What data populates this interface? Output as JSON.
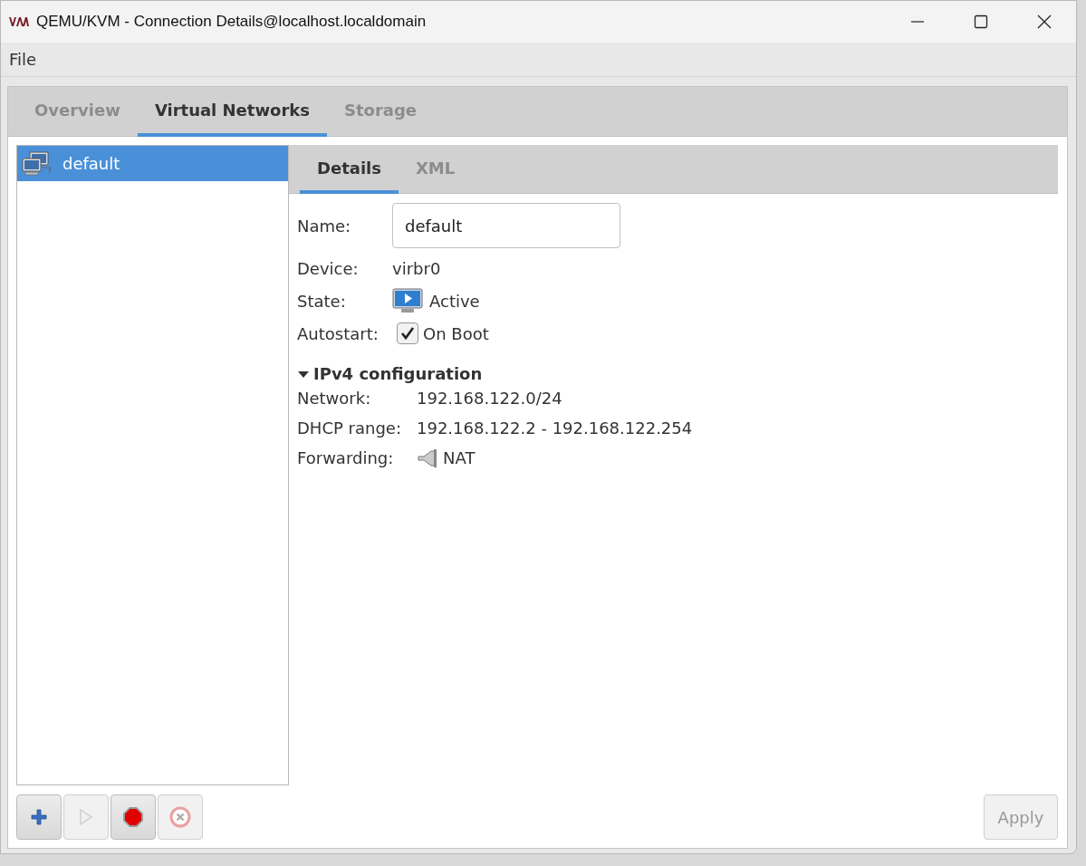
{
  "window": {
    "title": "QEMU/KVM - Connection Details@localhost.localdomain"
  },
  "menu": [
    "File"
  ],
  "tabs": [
    {
      "label": "Overview",
      "selected": false
    },
    {
      "label": "Virtual Networks",
      "selected": true
    },
    {
      "label": "Storage",
      "selected": false
    }
  ],
  "networks": [
    {
      "name": "default",
      "selected": true
    }
  ],
  "detail_tabs": [
    {
      "label": "Details",
      "selected": true
    },
    {
      "label": "XML",
      "selected": false
    }
  ],
  "details": [
    {
      "kind": "field",
      "label": "Name:",
      "value": "default"
    },
    {
      "kind": "text",
      "label": "Device:",
      "value": "virbr0"
    },
    {
      "kind": "state",
      "label": "State:",
      "value": "Active"
    },
    {
      "kind": "checkbox",
      "label": "Autostart:",
      "value": "On Boot",
      "checked": true
    }
  ],
  "ipv4": {
    "title": "IPv4 configuration",
    "expanded": true,
    "rows": [
      {
        "kind": "text",
        "label": "Network:",
        "value": "192.168.122.0/24"
      },
      {
        "kind": "text",
        "label": "DHCP range:",
        "value": "192.168.122.2 - 192.168.122.254"
      },
      {
        "kind": "forwarding",
        "label": "Forwarding:",
        "value": "NAT"
      }
    ]
  },
  "toolbar": [
    {
      "kind": "add",
      "disabled": false
    },
    {
      "kind": "start",
      "disabled": true
    },
    {
      "kind": "stop",
      "disabled": false
    },
    {
      "kind": "delete",
      "disabled": true
    }
  ],
  "apply": {
    "label": "Apply",
    "disabled": true
  }
}
